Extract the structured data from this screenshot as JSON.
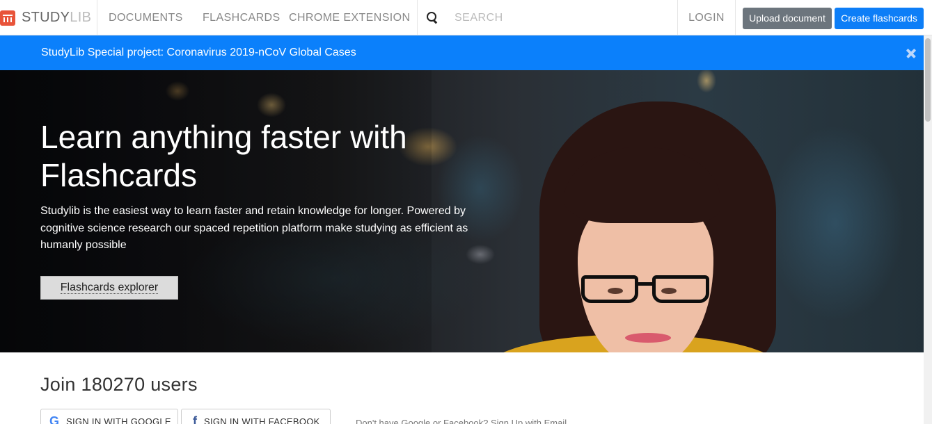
{
  "brand": {
    "name_part1": "STUDY",
    "name_part2": "LIB",
    "logo_icon": "studylib-logo-icon"
  },
  "nav": {
    "documents": "DOCUMENTS",
    "flashcards": "FLASHCARDS",
    "chrome_extension": "CHROME EXTENSION",
    "search_placeholder": "SEARCH",
    "login": "LOGIN",
    "upload_document": "Upload document",
    "create_flashcards": "Create flashcards"
  },
  "notice": {
    "text": "StudyLib Special project: Coronavirus 2019-nCoV Global Cases",
    "close_icon": "close-icon"
  },
  "hero": {
    "title_line1": "Learn anything faster with",
    "title_line2": "Flashcards",
    "description": "Studylib is the easiest way to learn faster and retain knowledge for longer. Powered by cognitive science research our spaced repetition platform make studying as efficient as humanly possible",
    "button": "Flashcards explorer"
  },
  "join": {
    "title": "Join 180270 users",
    "google_button": "SIGN IN WITH GOOGLE",
    "google_icon": "G",
    "facebook_button": "SIGN IN WITH FACEBOOK",
    "facebook_icon": "f",
    "signup_text": "Don't have Google or Facebook? Sign Up with Email"
  },
  "colors": {
    "primary": "#0d7ef7",
    "notice_bg": "#0b80fb",
    "secondary": "#6c757d",
    "brand_red": "#e8543a"
  }
}
